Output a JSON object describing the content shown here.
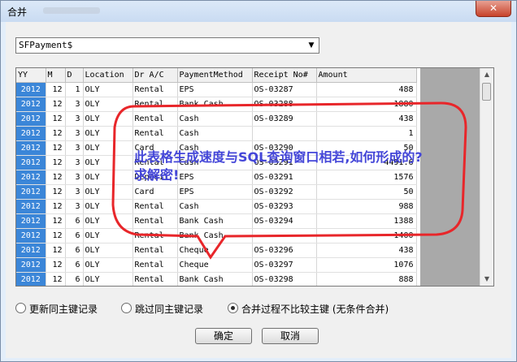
{
  "window": {
    "title": "合并",
    "close_glyph": "✕"
  },
  "combo": {
    "value": "SFPayment$"
  },
  "table": {
    "columns": [
      "YY",
      "M",
      "D",
      "Location",
      "Dr A/C",
      "PaymentMethod",
      "Receipt No#",
      "Amount"
    ],
    "rows": [
      [
        "2012",
        "12",
        "1",
        "OLY",
        "Rental",
        "EPS",
        "OS-03287",
        "488"
      ],
      [
        "2012",
        "12",
        "3",
        "OLY",
        "Rental",
        "Bank Cash",
        "OS-03288",
        "1880"
      ],
      [
        "2012",
        "12",
        "3",
        "OLY",
        "Rental",
        "Cash",
        "OS-03289",
        "438"
      ],
      [
        "2012",
        "12",
        "3",
        "OLY",
        "Rental",
        "Cash",
        "",
        "1"
      ],
      [
        "2012",
        "12",
        "3",
        "OLY",
        "Card",
        "Cash",
        "OS-03290",
        "50"
      ],
      [
        "2012",
        "12",
        "3",
        "OLY",
        "Rental",
        "Cash",
        "OS-03291",
        "4491.6"
      ],
      [
        "2012",
        "12",
        "3",
        "OLY",
        "Deposit",
        "EPS",
        "OS-03291",
        "1576"
      ],
      [
        "2012",
        "12",
        "3",
        "OLY",
        "Card",
        "EPS",
        "OS-03292",
        "50"
      ],
      [
        "2012",
        "12",
        "3",
        "OLY",
        "Rental",
        "Cash",
        "OS-03293",
        "988"
      ],
      [
        "2012",
        "12",
        "6",
        "OLY",
        "Rental",
        "Bank Cash",
        "OS-03294",
        "1388"
      ],
      [
        "2012",
        "12",
        "6",
        "OLY",
        "Rental",
        "Bank Cash",
        "",
        "1400"
      ],
      [
        "2012",
        "12",
        "6",
        "OLY",
        "Rental",
        "Cheque",
        "OS-03296",
        "438"
      ],
      [
        "2012",
        "12",
        "6",
        "OLY",
        "Rental",
        "Cheque",
        "OS-03297",
        "1076"
      ],
      [
        "2012",
        "12",
        "6",
        "OLY",
        "Rental",
        "Bank Cash",
        "OS-03298",
        "888"
      ]
    ]
  },
  "annotation": {
    "text": "此表格生成速度与SQL查询窗口相若,如何形成的?求解密!",
    "color": "#e8262a"
  },
  "options": [
    {
      "label": "更新同主键记录",
      "checked": false
    },
    {
      "label": "跳过同主键记录",
      "checked": false
    },
    {
      "label": "合并过程不比较主键 (无条件合并)",
      "checked": true
    }
  ],
  "buttons": {
    "ok": "确定",
    "cancel": "取消"
  },
  "icons": {
    "combo_arrow": "▼",
    "scroll_up": "▲",
    "scroll_down": "▼"
  }
}
